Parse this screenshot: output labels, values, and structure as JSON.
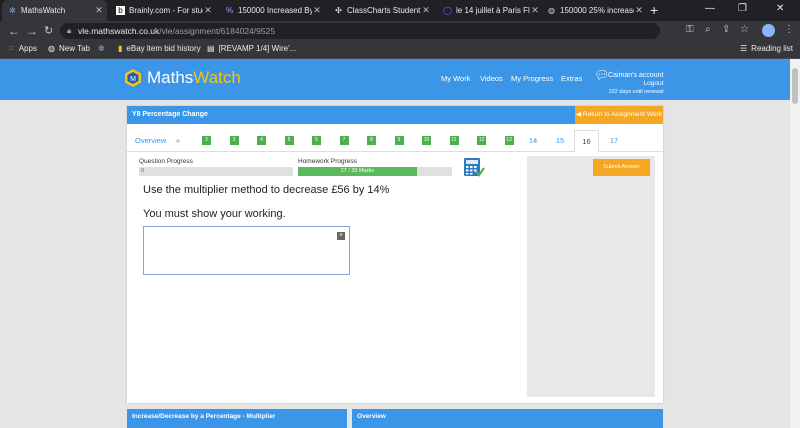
{
  "browser": {
    "tabs": [
      {
        "title": "MathsWatch",
        "icon": "mathswatch-favicon",
        "active": true
      },
      {
        "title": "Brainly.com - For stud",
        "icon": "brainly-favicon",
        "active": false
      },
      {
        "title": "150000 Increased By",
        "icon": "percent-favicon",
        "active": false
      },
      {
        "title": "ClassCharts Student A",
        "icon": "classcharts-favicon",
        "active": false
      },
      {
        "title": "le 14 juillet à Paris Fla",
        "icon": "search-favicon",
        "active": false
      },
      {
        "title": "150000 25% increase",
        "icon": "globe-favicon",
        "active": false
      }
    ],
    "new_tab": "+",
    "url_domain": "vle.mathswatch.co.uk",
    "url_path": "/vle/assignment/6184024/9525",
    "bookmarks": [
      {
        "label": "Apps",
        "icon": "apps-grid-icon"
      },
      {
        "label": "New Tab",
        "icon": "globe-icon"
      },
      {
        "label": "",
        "icon": "settings-bookmark-icon"
      },
      {
        "label": "eBay item bid history",
        "icon": "ebay-icon"
      },
      {
        "label": "[REVAMP 1/4] Wire'...",
        "icon": "document-icon"
      }
    ],
    "reading_list": "Reading list"
  },
  "site": {
    "logo_text_a": "Maths",
    "logo_text_b": "Watch",
    "nav": [
      "My Work",
      "Videos",
      "My Progress",
      "Extras"
    ],
    "account_name": "Caiman's account",
    "logout": "Logout",
    "renewal": "222 days until renewal"
  },
  "assignment": {
    "title": "Y8 Percentage Change",
    "return_label": "Return to Assignment Work",
    "overview_label": "Overview",
    "prev_label": "«",
    "done_tabs": [
      "2",
      "3",
      "4",
      "5",
      "6",
      "7",
      "8",
      "9",
      "10",
      "11",
      "12",
      "13"
    ],
    "open_tabs": [
      "14",
      "15",
      "16",
      "17"
    ],
    "current_tab": "16",
    "question_progress_label": "Question Progress",
    "question_progress_value": "0",
    "question_progress_fraction": 0,
    "homework_progress_label": "Homework Progress",
    "homework_progress_text": "27 / 35 Marks",
    "homework_progress_fraction": 0.771,
    "question_line1": "Use the multiplier method to decrease £56 by 14%",
    "question_line2": "You must show your working.",
    "submit_label": "Submit Answer"
  },
  "bottom": {
    "left_title": "Increase/Decrease by a Percentage - Multiplier",
    "right_title": "Overview"
  },
  "colors": {
    "brand_blue": "#3b96e8",
    "accent_orange": "#f5a623",
    "done_green": "#4caf50",
    "logo_yellow": "#f5c31a"
  }
}
